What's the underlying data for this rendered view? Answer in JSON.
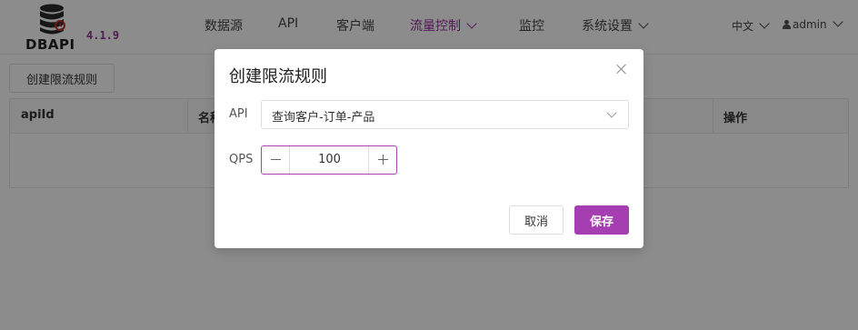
{
  "app": {
    "logo_text": "DBAPI",
    "version": "4.1.9",
    "accent_color": "#9b2ea3"
  },
  "nav": {
    "items": [
      {
        "label": "数据源"
      },
      {
        "label": "API"
      },
      {
        "label": "客户端"
      },
      {
        "label": "流量控制",
        "active": true,
        "has_dropdown": true
      },
      {
        "label": "监控"
      },
      {
        "label": "系统设置",
        "has_dropdown": true
      }
    ],
    "language": "中文",
    "user": "admin"
  },
  "page": {
    "create_button": "创建限流规则",
    "table_headers": [
      "apiId",
      "名称",
      "操作"
    ]
  },
  "modal": {
    "title": "创建限流规则",
    "api_label": "API",
    "api_value": "查询客户-订单-产品",
    "qps_label": "QPS",
    "qps_value": "100",
    "cancel_label": "取消",
    "save_label": "保存"
  }
}
